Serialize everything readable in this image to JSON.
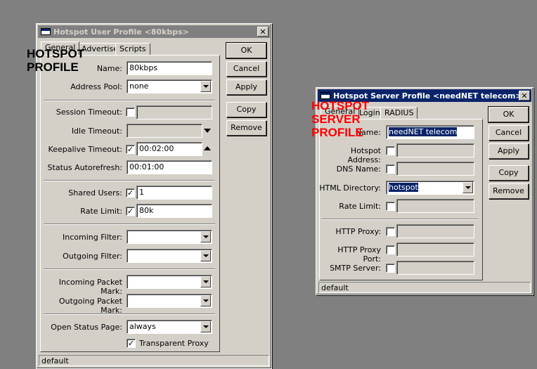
{
  "annotations": {
    "user_profile_line1": "HOTSPOT",
    "user_profile_line2": "PROFILE",
    "server_profile_line1": "HOTSPOT",
    "server_profile_line2": "SERVER",
    "server_profile_line3": "PROFILE",
    "user_color": "#000000",
    "server_color": "#ff0000"
  },
  "user_profile": {
    "title": "Hotspot User Profile <80kbps>",
    "close": "✕",
    "tabs": [
      "General",
      "Advertise",
      "Scripts"
    ],
    "fields": {
      "name": {
        "label": "Name:",
        "value": "80kbps"
      },
      "address_pool": {
        "label": "Address Pool:",
        "value": "none"
      },
      "session_timeout": {
        "label": "Session Timeout:",
        "value": ""
      },
      "idle_timeout": {
        "label": "Idle Timeout:",
        "value": ""
      },
      "keepalive_timeout": {
        "label": "Keepalive Timeout:",
        "value": "00:02:00"
      },
      "status_autorefresh": {
        "label": "Status Autorefresh:",
        "value": "00:01:00"
      },
      "shared_users": {
        "label": "Shared Users:",
        "value": "1"
      },
      "rate_limit": {
        "label": "Rate Limit:",
        "value": "80k"
      },
      "incoming_filter": {
        "label": "Incoming Filter:",
        "value": ""
      },
      "outgoing_filter": {
        "label": "Outgoing Filter:",
        "value": ""
      },
      "incoming_packet_mark": {
        "label": "Incoming Packet Mark:",
        "value": ""
      },
      "outgoing_packet_mark": {
        "label": "Outgoing Packet Mark:",
        "value": ""
      },
      "open_status_page": {
        "label": "Open Status Page:",
        "value": "always"
      },
      "transparent_proxy": {
        "label": "Transparent Proxy",
        "checked": true
      }
    },
    "buttons": {
      "ok": "OK",
      "cancel": "Cancel",
      "apply": "Apply",
      "copy": "Copy",
      "remove": "Remove"
    },
    "status": "default"
  },
  "server_profile": {
    "title": "Hotspot Server Profile <needNET telecom>",
    "close": "✕",
    "tabs": [
      "General",
      "Login",
      "RADIUS"
    ],
    "fields": {
      "name": {
        "label": "Name:",
        "value": "needNET telecom"
      },
      "hotspot_address": {
        "label": "Hotspot Address:",
        "value": ""
      },
      "dns_name": {
        "label": "DNS Name:",
        "value": ""
      },
      "html_directory": {
        "label": "HTML Directory:",
        "value": "hotspot"
      },
      "rate_limit": {
        "label": "Rate Limit:",
        "value": ""
      },
      "http_proxy": {
        "label": "HTTP Proxy:",
        "value": ""
      },
      "http_proxy_port": {
        "label": "HTTP Proxy Port:",
        "value": ""
      },
      "smtp_server": {
        "label": "SMTP Server:",
        "value": ""
      }
    },
    "buttons": {
      "ok": "OK",
      "cancel": "Cancel",
      "apply": "Apply",
      "copy": "Copy",
      "remove": "Remove"
    },
    "status": "default"
  },
  "checkmark": "✓"
}
